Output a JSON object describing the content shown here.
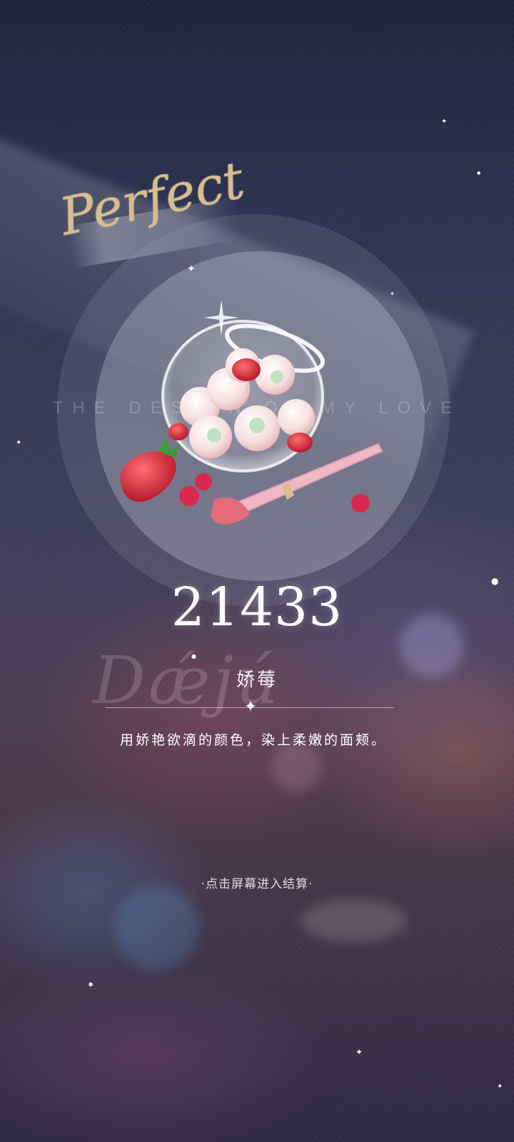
{
  "result": {
    "grade": "Perfect",
    "tagline": "THE DESIGN OF MY LOVE",
    "score": "21433",
    "item_name": "娇莓",
    "description": "用娇艳欲滴的颜色，染上柔嫩的面颊。",
    "continue_hint": "点击屏幕进入结算"
  },
  "colors": {
    "grade_gold": "#d8bd8e",
    "score_white": "#ffffff",
    "background_top": "#1e2436",
    "background_bottom": "#2f2a42"
  },
  "icons": {
    "item": "strawberry-bowl-with-makeup-brush",
    "divider": "four-point-star"
  }
}
